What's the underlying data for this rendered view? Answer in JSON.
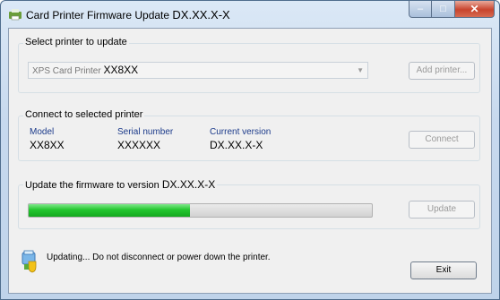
{
  "window": {
    "title": "Card Printer Firmware Update",
    "title_version": "DX.XX.X-X",
    "icon": "printer-app-icon"
  },
  "caption_buttons": {
    "minimize": "–",
    "maximize": "□",
    "close": "✕"
  },
  "select_group": {
    "label": "Select printer to update",
    "combo_prefix": "XPS Card Printer",
    "combo_value": "XX8XX",
    "add_button": "Add printer..."
  },
  "connect_group": {
    "label": "Connect to selected printer",
    "columns": [
      {
        "label": "Model",
        "value": "XX8XX"
      },
      {
        "label": "Serial number",
        "value": "XXXXXX"
      },
      {
        "label": "Current version",
        "value": "DX.XX.X-X"
      }
    ],
    "connect_button": "Connect"
  },
  "update_group": {
    "label_prefix": "Update the firmware to version",
    "label_version": "DX.XX.X-X",
    "progress_fraction": 0.47,
    "update_button": "Update"
  },
  "status": {
    "text": "Updating... Do not disconnect or power down the printer.",
    "icon": "printer-shield-icon"
  },
  "exit_button": "Exit",
  "colors": {
    "progress": "#23c62e",
    "column_label": "#1b3a8a",
    "close_button": "#c8442d"
  }
}
